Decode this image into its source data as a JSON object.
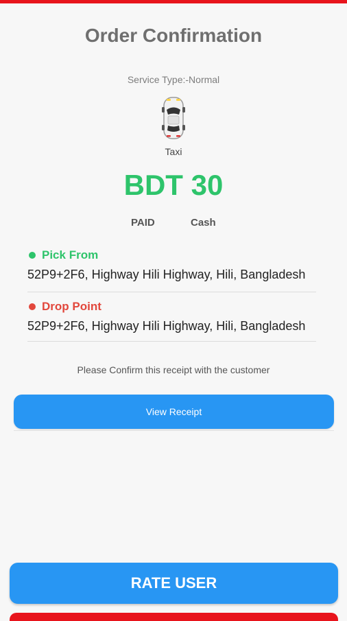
{
  "header": {
    "title": "Order Confirmation"
  },
  "service": {
    "label": "Service Type:-Normal"
  },
  "vehicle": {
    "icon": "car-icon",
    "name": "Taxi"
  },
  "fare": {
    "amount_text": "BDT 30",
    "status": "PAID",
    "method": "Cash"
  },
  "pickup": {
    "label": "Pick From",
    "address": "52P9+2F6, Highway Hili Highway, Hili, Bangladesh"
  },
  "dropoff": {
    "label": "Drop Point",
    "address": "52P9+2F6, Highway Hili Highway, Hili, Bangladesh"
  },
  "receipt": {
    "note": "Please Confirm this receipt with the customer",
    "button_label": "View Receipt"
  },
  "footer": {
    "rate_button_label": "RATE USER"
  },
  "colors": {
    "accent": "#2896f3",
    "fare": "#2ec46b",
    "pickup": "#2ec46b",
    "drop": "#e2473c",
    "bar": "#e8141c"
  }
}
